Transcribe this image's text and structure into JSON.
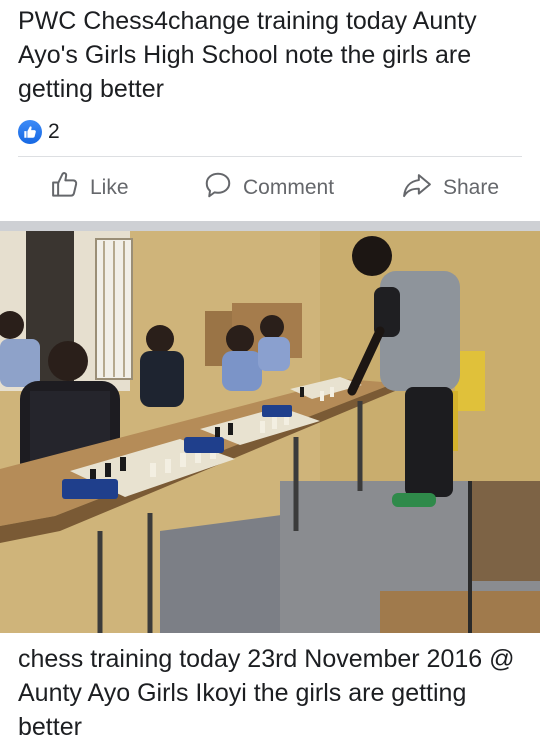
{
  "post": {
    "text": "PWC Chess4change training today Aunty Ayo's Girls High School note the girls are getting better",
    "reaction_icon": "like-icon",
    "reaction_count": "2"
  },
  "actions": {
    "like_label": "Like",
    "comment_label": "Comment",
    "share_label": "Share"
  },
  "photo": {
    "caption": "chess training today 23rd November 2016 @ Aunty Ayo Girls Ikoyi the girls are getting better"
  },
  "colors": {
    "accent": "#1877f2",
    "muted_text": "#65676b",
    "separator": "#ced0d4"
  }
}
